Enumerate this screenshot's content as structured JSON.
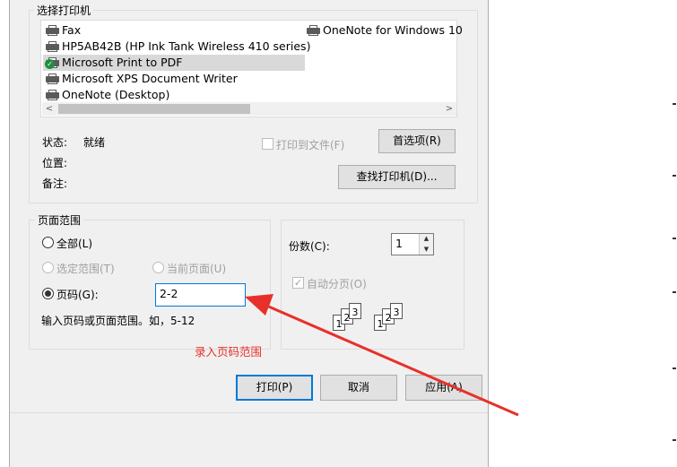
{
  "printer_group": {
    "title": "选择打印机",
    "printers": [
      {
        "name": "Fax",
        "default": false
      },
      {
        "name": "HP5AB42B (HP Ink Tank Wireless 410 series)",
        "default": false
      },
      {
        "name": "Microsoft Print to PDF",
        "default": true
      },
      {
        "name": "Microsoft XPS Document Writer",
        "default": false
      },
      {
        "name": "OneNote (Desktop)",
        "default": false
      },
      {
        "name": "OneNote for Windows 10",
        "default": false
      }
    ],
    "status_label": "状态:",
    "status_value": "就绪",
    "location_label": "位置:",
    "comment_label": "备注:",
    "print_to_file": "打印到文件(F)",
    "preferences_button": "首选项(R)",
    "find_printer_button": "查找打印机(D)..."
  },
  "page_range": {
    "title": "页面范围",
    "all": "全部(L)",
    "selection": "选定范围(T)",
    "current_page": "当前页面(U)",
    "pages": "页码(G):",
    "pages_value": "2-2",
    "hint": "输入页码或页面范围。如，5-12"
  },
  "copies": {
    "label": "份数(C):",
    "value": "1",
    "collate": "自动分页(O)"
  },
  "annotation": "录入页码范围",
  "buttons": {
    "print": "打印(P)",
    "cancel": "取消",
    "apply": "应用(A)"
  },
  "colors": {
    "annotation": "#e8302a",
    "focus": "#0078d7"
  }
}
